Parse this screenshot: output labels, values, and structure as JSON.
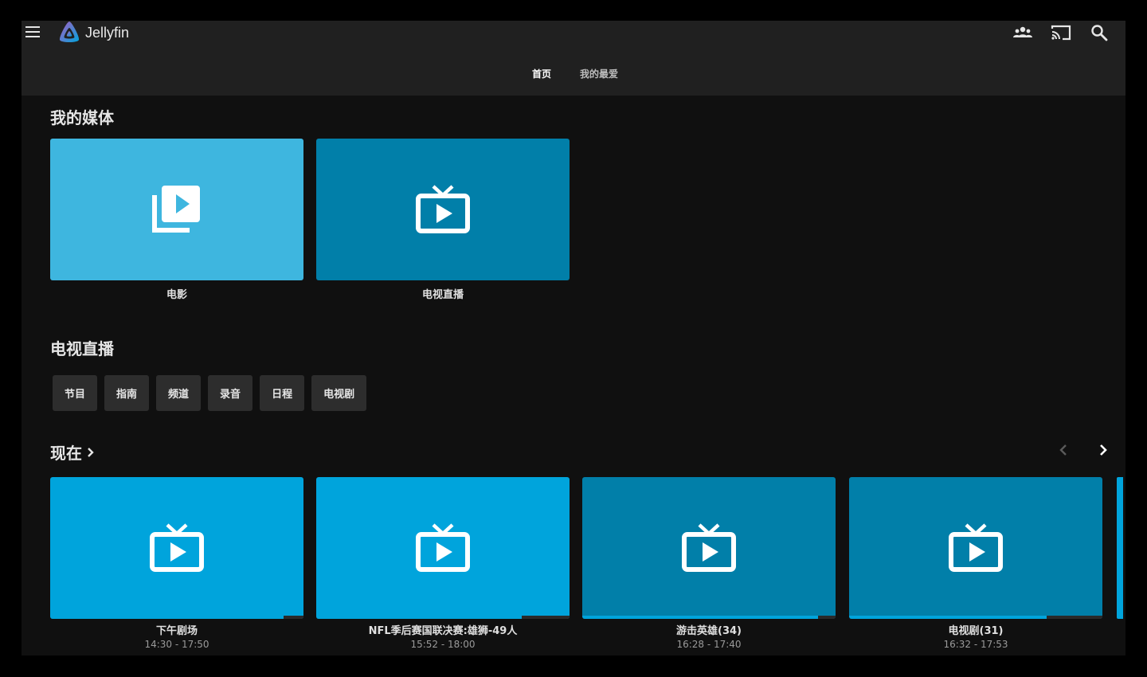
{
  "app": {
    "name": "Jellyfin"
  },
  "header": {
    "tabs": [
      {
        "label": "首页",
        "active": true
      },
      {
        "label": "我的最爱",
        "active": false
      }
    ]
  },
  "my_media": {
    "title": "我的媒体",
    "items": [
      {
        "label": "电影",
        "icon": "video-library-icon",
        "color": "#3eb6df"
      },
      {
        "label": "电视直播",
        "icon": "live-tv-icon",
        "color": "#017fa9"
      }
    ]
  },
  "live_tv": {
    "title": "电视直播",
    "buttons": [
      "节目",
      "指南",
      "频道",
      "录音",
      "日程",
      "电视剧"
    ]
  },
  "now": {
    "title": "现在",
    "items": [
      {
        "title": "下午剧场",
        "time": "14:30 - 17:50",
        "color": "#00a4dc",
        "progress": 0.92
      },
      {
        "title": "NFL季后赛国联决赛:雄狮-49人",
        "time": "15:52 - 18:00",
        "color": "#00a4dc",
        "progress": 0.81
      },
      {
        "title": "游击英雄(34)",
        "time": "16:28 - 17:40",
        "color": "#017fa9",
        "progress": 0.93
      },
      {
        "title": "电视剧(31)",
        "time": "16:32 - 17:53",
        "color": "#017fa9",
        "progress": 0.78
      }
    ]
  },
  "colors": {
    "accent": "#00a4dc",
    "header_bg": "#202020",
    "page_bg": "#101010",
    "button_bg": "#2d2d2d"
  }
}
